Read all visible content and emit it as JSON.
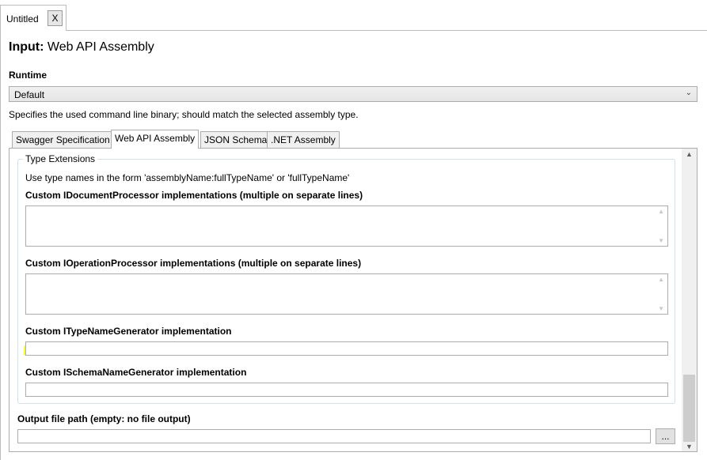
{
  "document_tab": {
    "title": "Untitled",
    "close_label": "X"
  },
  "page": {
    "title_prefix": "Input:",
    "title_name": "Web API Assembly"
  },
  "runtime": {
    "label": "Runtime",
    "selected": "Default",
    "help": "Specifies the used command line binary; should match the selected assembly type."
  },
  "tabs": [
    {
      "label": "Swagger Specification",
      "selected": false
    },
    {
      "label": "Web API Assembly",
      "selected": true
    },
    {
      "label": "JSON Schema",
      "selected": false
    },
    {
      "label": ".NET Assembly",
      "selected": false
    }
  ],
  "type_extensions": {
    "group_title": "Type Extensions",
    "note": "Use type names in the form 'assemblyName:fullTypeName' or 'fullTypeName'",
    "document_processor_label": "Custom IDocumentProcessor implementations (multiple on separate lines)",
    "document_processor_value": "",
    "operation_processor_label": "Custom IOperationProcessor implementations (multiple on separate lines)",
    "operation_processor_value": "",
    "type_name_generator_label": "Custom ITypeNameGenerator implementation",
    "type_name_generator_value": "",
    "schema_name_generator_label": "Custom ISchemaNameGenerator implementation",
    "schema_name_generator_value": ""
  },
  "output": {
    "label": "Output file path (empty: no file output)",
    "value": "",
    "browse_label": "..."
  },
  "colors": {
    "highlight": "#f5ff00",
    "border": "#acacac",
    "group_border": "#d5dfe5"
  }
}
